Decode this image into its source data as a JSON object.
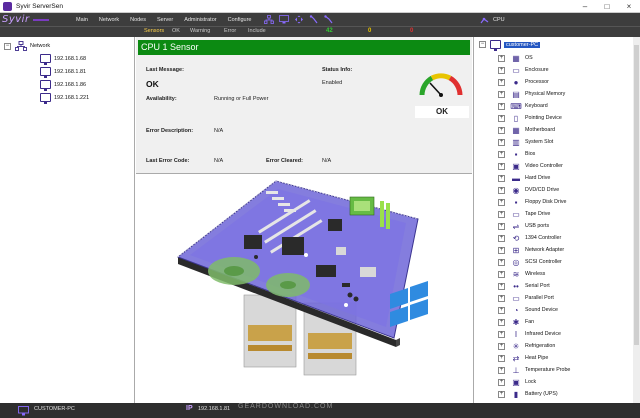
{
  "window": {
    "title": "Syvir ServerSen"
  },
  "logo": {
    "text": "Syvir"
  },
  "menu": [
    "Main",
    "Network",
    "Nodes",
    "Server",
    "Administrator",
    "Configure"
  ],
  "cpu_indicator": {
    "label": "CPU"
  },
  "status_tabs": [
    "Sensors",
    "OK",
    "Warning",
    "Error",
    "Include"
  ],
  "status_counts": {
    "ok": "42",
    "warning": "0",
    "error": "0"
  },
  "left_tree": {
    "root": "Network",
    "children": [
      "192.168.1.68",
      "192.168.1.81",
      "192.168.1.86",
      "192.168.1.221"
    ]
  },
  "sensor": {
    "header": "CPU 1 Sensor",
    "last_message_label": "Last Message:",
    "last_message": "OK",
    "status_info_label": "Status Info:",
    "status_info": "Enabled",
    "availability_label": "Availability:",
    "availability": "Running or Full Power",
    "error_desc_label": "Error Description:",
    "error_desc": "N/A",
    "last_error_code_label": "Last Error Code:",
    "last_error_code": "N/A",
    "error_cleared_label": "Error Cleared:",
    "error_cleared": "N/A",
    "gauge_label": "OK"
  },
  "right_tree": {
    "root": "customer-PC",
    "items": [
      {
        "label": "OS",
        "icon": "os-icon",
        "color": "#3b2a8a"
      },
      {
        "label": "Enclosure",
        "icon": "enclosure-icon",
        "color": "#3b2a8a"
      },
      {
        "label": "Processor",
        "icon": "processor-icon",
        "color": "#3b2a8a"
      },
      {
        "label": "Physical Memory",
        "icon": "memory-icon",
        "color": "#3b2a8a"
      },
      {
        "label": "Keyboard",
        "icon": "keyboard-icon",
        "color": "#3b2a8a"
      },
      {
        "label": "Pointing Device",
        "icon": "mouse-icon",
        "color": "#3b2a8a"
      },
      {
        "label": "Motherboard",
        "icon": "motherboard-icon",
        "color": "#3b2a8a"
      },
      {
        "label": "System Slot",
        "icon": "slot-icon",
        "color": "#3b2a8a"
      },
      {
        "label": "Bios",
        "icon": "bios-icon",
        "color": "#3b2a8a"
      },
      {
        "label": "Video Controller",
        "icon": "video-icon",
        "color": "#3b2a8a"
      },
      {
        "label": "Hard Drive",
        "icon": "hdd-icon",
        "color": "#3b2a8a"
      },
      {
        "label": "DVD/CD Drive",
        "icon": "disc-icon",
        "color": "#3b2a8a"
      },
      {
        "label": "Floppy Disk Drive",
        "icon": "floppy-icon",
        "color": "#3b2a8a"
      },
      {
        "label": "Tape Drive",
        "icon": "tape-icon",
        "color": "#3b2a8a"
      },
      {
        "label": "USB ports",
        "icon": "usb-icon",
        "color": "#3b2a8a"
      },
      {
        "label": "1394 Controller",
        "icon": "firewire-icon",
        "color": "#3b2a8a"
      },
      {
        "label": "Network Adapter",
        "icon": "network-icon",
        "color": "#3b2a8a"
      },
      {
        "label": "SCSI Controller",
        "icon": "scsi-icon",
        "color": "#3b2a8a"
      },
      {
        "label": "Wireless",
        "icon": "wireless-icon",
        "color": "#3b2a8a"
      },
      {
        "label": "Serial Port",
        "icon": "serial-icon",
        "color": "#3b2a8a"
      },
      {
        "label": "Parallel Port",
        "icon": "parallel-icon",
        "color": "#3b2a8a"
      },
      {
        "label": "Sound Device",
        "icon": "sound-icon",
        "color": "#3b2a8a"
      },
      {
        "label": "Fan",
        "icon": "fan-icon",
        "color": "#3b2a8a"
      },
      {
        "label": "Infrared Device",
        "icon": "infrared-icon",
        "color": "#3b2a8a"
      },
      {
        "label": "Refrigeration",
        "icon": "refrigeration-icon",
        "color": "#3b2a8a"
      },
      {
        "label": "Heat Pipe",
        "icon": "heatpipe-icon",
        "color": "#3b2a8a"
      },
      {
        "label": "Temperature Probe",
        "icon": "thermometer-icon",
        "color": "#3b2a8a"
      },
      {
        "label": "Lock",
        "icon": "lock-icon",
        "color": "#3b2a8a"
      },
      {
        "label": "Battery (UPS)",
        "icon": "battery-icon",
        "color": "#3b2a8a"
      }
    ]
  },
  "bottom": {
    "pc": "CUSTOMER-PC",
    "ip_label": "IP",
    "ip": "192.168.1.81",
    "watermark": "GEARDOWNLOAD.COM"
  },
  "colors": {
    "accent": "#3b2a8a",
    "sensor_header": "#0c8a12",
    "ok_count": "#33cc33",
    "warn_count": "#e8c400",
    "error_count": "#e03030"
  }
}
